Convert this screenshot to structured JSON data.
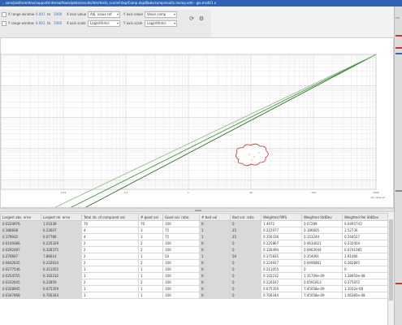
{
  "window": {
    "title": "...sers/platform/dev/support/internal/tools/plots/results/ldm/tests_run/ref.dxp/Comp.dxp/Babs/compresults.mcmp.xml - gio.mcdl/1.x"
  },
  "toolbar": {
    "x_range_label": "X range window",
    "x_range_min": "0.001",
    "x_range_to": "to",
    "x_range_max": "1000",
    "y_range_label": "Y range window",
    "y_range_min": "0.001",
    "y_range_to": "to",
    "y_range_max": "1000",
    "x_axis_value_label": "X axis value",
    "x_axis_value": "Adj. value ref",
    "y_axis_value_label": "Y axis value",
    "y_axis_value": "Value comp",
    "x_axis_scale_label": "X axis scale",
    "x_axis_scale": "Logarithmic",
    "y_axis_scale_label": "Y axis scale",
    "y_axis_scale": "Logarithmic",
    "refresh_icon": "refresh-icon",
    "settings_icon": "gear-icon"
  },
  "chart_data": {
    "type": "line",
    "xscale": "log",
    "yscale": "log",
    "xlim": [
      0.001,
      1000
    ],
    "xticks": [
      "0.01",
      "0.1",
      "1",
      "10",
      "100",
      "1000"
    ],
    "x_corner_label": "Adj. value ref",
    "series": [
      {
        "values": [
          [
            0.001,
            0.001
          ],
          [
            1000,
            1000
          ]
        ],
        "color": "#3c9a3c"
      },
      {
        "values": [
          [
            0.001,
            0.0005
          ],
          [
            1000,
            1000
          ]
        ],
        "color": "#2b6e2b"
      },
      {
        "values": [
          [
            0.001,
            0.002
          ],
          [
            1000,
            1000
          ]
        ],
        "color": "#8fbf7f"
      }
    ],
    "grid": true,
    "annotation_marker": "cloud-marker",
    "annotation_color": "#cc2222"
  },
  "table": {
    "columns": [
      "Largest abs. error",
      "Largest rel. error",
      "Total nb. of compared val",
      "# good val",
      "Good val. ratio",
      "# bad val",
      "Bad val. ratio",
      "Weighted RMS",
      "Weighted StdDev",
      "Weighted Rel StdDev"
    ],
    "rows": [
      [
        "0.0224976",
        "1.03338",
        "70",
        "70",
        "100",
        "0",
        "0",
        "1.4672",
        "0.07289",
        "0.0495743"
      ],
      [
        "0.186608",
        "0.23007",
        "4",
        "3",
        "75",
        "1",
        "25",
        "0.222977",
        "0.186605",
        "1.52736"
      ],
      [
        "0.179932",
        "0.07766",
        "4",
        "3",
        "75",
        "1",
        "25",
        "0.356336",
        "0.153244",
        "0.244527"
      ],
      [
        "0.0149386",
        "0.235329",
        "2",
        "2",
        "100",
        "0",
        "0",
        "0.225867",
        "0.0634021",
        "0.232404"
      ],
      [
        "0.0292487",
        "0.328375",
        "2",
        "2",
        "100",
        "0",
        "0",
        "0.126494",
        "0.0663044",
        "0.0741085"
      ],
      [
        "0.270607",
        "7.86614",
        "2",
        "1",
        "50",
        "1",
        "50",
        "0.375835",
        "0.354091",
        "2.91066"
      ],
      [
        "0.0642635",
        "0.232633",
        "2",
        "2",
        "100",
        "0",
        "0",
        "0.224927",
        "0.0696861",
        "0.282845"
      ],
      [
        "0.0277546",
        "0.311055",
        "1",
        "1",
        "100",
        "0",
        "0",
        "0.211055",
        "0",
        "0"
      ],
      [
        "0.0254755",
        "0.102232",
        "1",
        "1",
        "100",
        "0",
        "0",
        "0.102232",
        "1.31709e-09",
        "1.28950e-08"
      ],
      [
        "0.0332645",
        "0.22859",
        "2",
        "2",
        "100",
        "0",
        "0",
        "0.220167",
        "0.0591813",
        "0.275972"
      ],
      [
        "0.0328945",
        "0.675359",
        "1",
        "1",
        "100",
        "0",
        "0",
        "0.675359",
        "7.45058e-09",
        "1.1032e-08"
      ],
      [
        "0.0347468",
        "0.700344",
        "1",
        "1",
        "100",
        "0",
        "0",
        "0.700344",
        "7.45058e-09",
        "1.06385e-08"
      ]
    ]
  }
}
